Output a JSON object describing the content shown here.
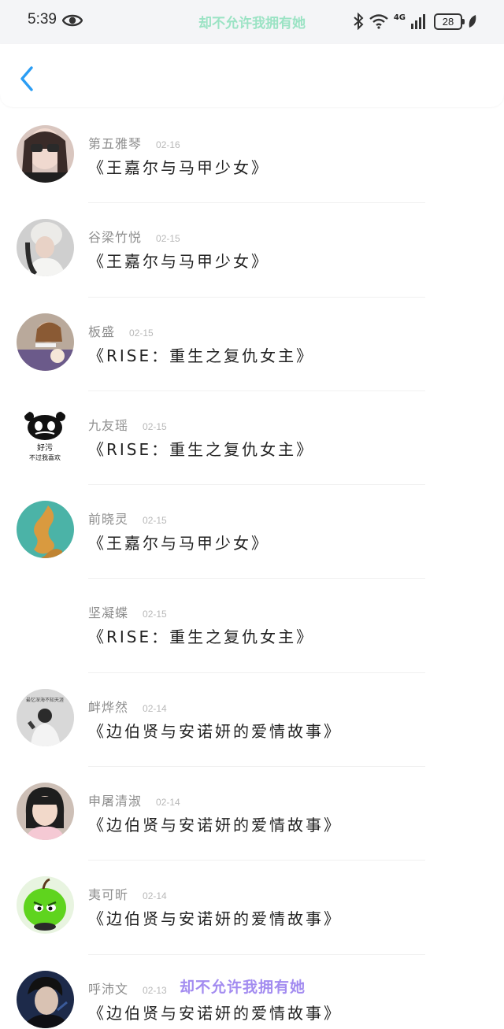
{
  "status_bar": {
    "time": "5:39",
    "carrier_text": "却不允许我拥有她",
    "network": "4G",
    "battery": "28",
    "icons": [
      "eye-icon",
      "bluetooth-icon",
      "wifi-icon",
      "signal-icon",
      "battery-icon",
      "leaf-icon"
    ]
  },
  "header": {
    "back_icon": "chevron-left-icon"
  },
  "colors": {
    "accent": "#2a9df4",
    "watermark": "#a38cf0",
    "carrier_text": "#9be3c4"
  },
  "rows": [
    {
      "user": "第五雅琴",
      "date": "02-16",
      "title": "《王嘉尔与马甲少女》"
    },
    {
      "user": "谷梁竹悦",
      "date": "02-15",
      "title": "《王嘉尔与马甲少女》"
    },
    {
      "user": "板盛",
      "date": "02-15",
      "title": "《RISE：重生之复仇女主》"
    },
    {
      "user": "九友瑶",
      "date": "02-15",
      "title": "《RISE：重生之复仇女主》",
      "avatar_text": [
        "好污",
        "不过我喜欢"
      ]
    },
    {
      "user": "前晓灵",
      "date": "02-15",
      "title": "《王嘉尔与马甲少女》"
    },
    {
      "user": "坚凝蝶",
      "date": "02-15",
      "title": "《RISE：重生之复仇女主》"
    },
    {
      "user": "衅烨然",
      "date": "02-14",
      "title": "《边伯贤与安诺妍的爱情故事》",
      "avatar_text": [
        "最忆深海不知天涯"
      ]
    },
    {
      "user": "申屠清淑",
      "date": "02-14",
      "title": "《边伯贤与安诺妍的爱情故事》"
    },
    {
      "user": "夷可昕",
      "date": "02-14",
      "title": "《边伯贤与安诺妍的爱情故事》"
    },
    {
      "user": "呼沛文",
      "date": "02-13",
      "title": "《边伯贤与安诺妍的爱情故事》"
    }
  ],
  "watermark": "却不允许我拥有她"
}
